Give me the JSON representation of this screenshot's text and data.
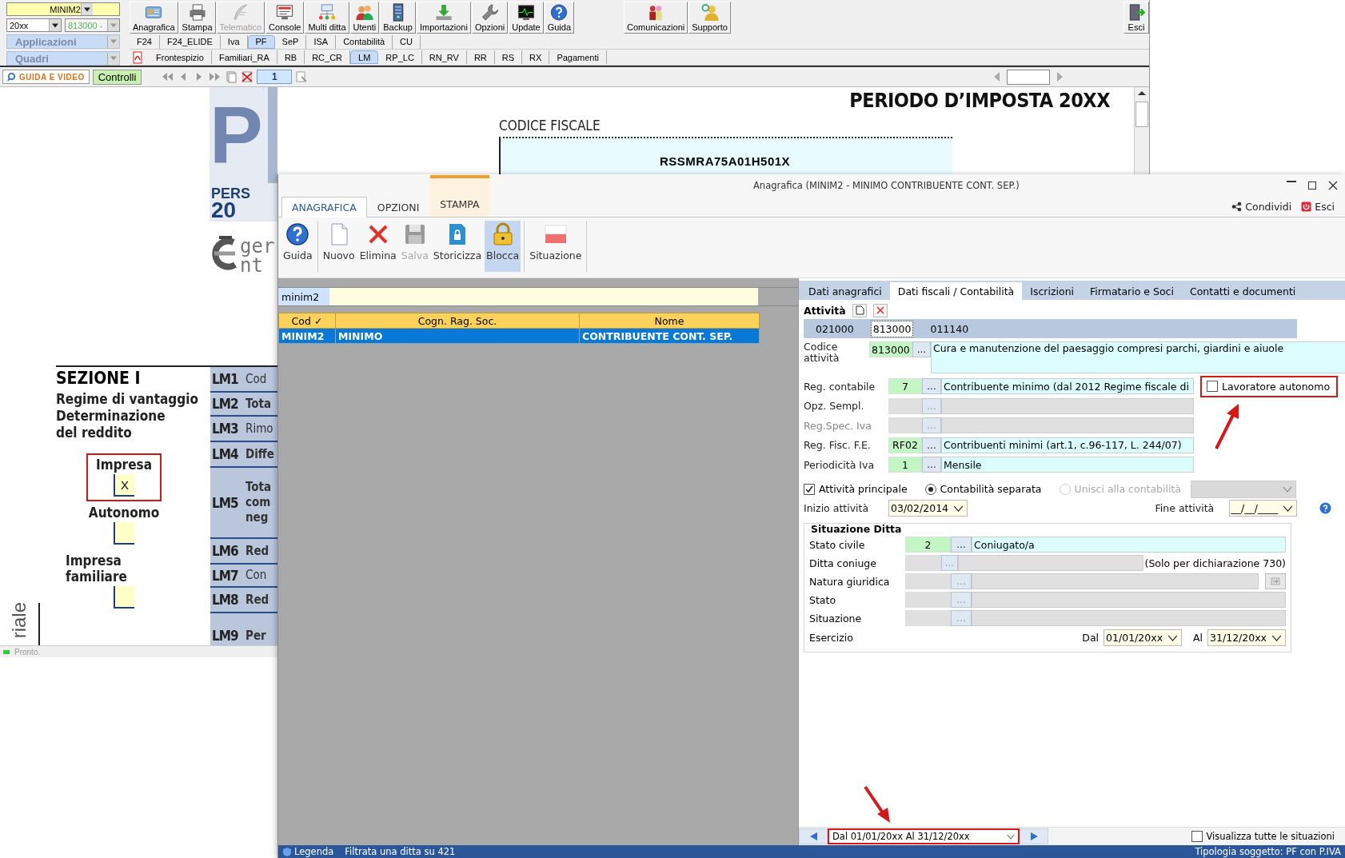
{
  "main_window": {
    "company_selector": {
      "value": "MINIM2"
    },
    "year_selector": {
      "value": "20xx"
    },
    "activity_selector": {
      "value": "813000 -",
      "disabled": true
    },
    "toolbar": [
      {
        "label": "Anagrafica",
        "disabled": false
      },
      {
        "label": "Stampa",
        "disabled": false
      },
      {
        "label": "Telematico",
        "disabled": true
      },
      {
        "label": "Console",
        "disabled": false
      },
      {
        "label": "Multi ditta",
        "disabled": false
      },
      {
        "label": "Utenti",
        "disabled": false
      },
      {
        "label": "Backup",
        "disabled": false
      },
      {
        "label": "Importazioni",
        "disabled": false
      },
      {
        "label": "Opzioni",
        "disabled": false
      },
      {
        "label": "Update",
        "disabled": false
      },
      {
        "label": "Guida",
        "disabled": false
      }
    ],
    "toolbar_right": [
      {
        "label": "Comunicazioni"
      },
      {
        "label": "Supporto"
      }
    ],
    "exit_button": {
      "label": "Esci"
    },
    "applications": {
      "label": "Applicazioni",
      "tabs": [
        {
          "label": "F24",
          "selected": false
        },
        {
          "label": "F24_ELIDE",
          "selected": false
        },
        {
          "label": "Iva",
          "selected": false
        },
        {
          "label": "PF",
          "selected": true
        },
        {
          "label": "SeP",
          "selected": false
        },
        {
          "label": "ISA",
          "selected": false
        },
        {
          "label": "Contabilità",
          "selected": false
        },
        {
          "label": "CU",
          "selected": false
        }
      ]
    },
    "sections": {
      "label": "Quadri",
      "tabs": [
        {
          "label": "Frontespizio",
          "selected": false
        },
        {
          "label": "Familiari_RA",
          "selected": false
        },
        {
          "label": "RB",
          "selected": false
        },
        {
          "label": "RC_CR",
          "selected": false
        },
        {
          "label": "LM",
          "selected": true
        },
        {
          "label": "RP_LC",
          "selected": false
        },
        {
          "label": "RN_RV",
          "selected": false
        },
        {
          "label": "RR",
          "selected": false
        },
        {
          "label": "RS",
          "selected": false
        },
        {
          "label": "RX",
          "selected": false
        },
        {
          "label": "Pagamenti",
          "selected": false
        }
      ]
    },
    "guide_button": {
      "label": "GUIDA E VIDEO"
    },
    "checks_button": {
      "label": "Controlli"
    },
    "page_field": {
      "value": "1"
    },
    "document": {
      "period_title": "PERIODO D’IMPOSTA 20XX",
      "logo": {
        "letters": "P",
        "lines": [
          "PERS",
          "20"
        ]
      },
      "agency_logo": {
        "lines": [
          "ger",
          "nt"
        ]
      },
      "tax_code_label": "CODICE FISCALE",
      "tax_code": "RSSMRA75A01H501X",
      "section_title": "SEZIONE I",
      "section_subtitle": [
        "Regime di vantaggio",
        "Determinazione",
        "del reddito"
      ],
      "options": [
        {
          "label": "Impresa",
          "mark": "X",
          "highlighted": true
        },
        {
          "label": "Autonomo",
          "highlighted": false
        },
        {
          "label": "Impresa familiare",
          "highlighted": false
        }
      ],
      "rows": [
        {
          "code": "LM1",
          "label": [
            "Cod"
          ],
          "bold": false
        },
        {
          "code": "LM2",
          "label": [
            "Tota"
          ],
          "bold": true
        },
        {
          "code": "LM3",
          "label": [
            "Rimo"
          ],
          "bold": false
        },
        {
          "code": "LM4",
          "label": [
            "Diffe"
          ],
          "bold": true
        },
        {
          "code": "LM5",
          "label": [
            "Tota",
            "com",
            "neg"
          ],
          "bold": true
        },
        {
          "code": "LM6",
          "label": [
            "Red"
          ],
          "bold": true
        },
        {
          "code": "LM7",
          "label": [
            "Con"
          ],
          "bold": false
        },
        {
          "code": "LM8",
          "label": [
            "Red"
          ],
          "bold": true
        },
        {
          "code": "LM9",
          "label": [
            "Per"
          ],
          "bold": true
        }
      ],
      "side_text": "riale"
    },
    "status": "Pronto."
  },
  "dialog": {
    "title": "Anagrafica (MINIM2 - MINIMO CONTRIBUENTE CONT. SEP.)",
    "ribbon_tabs": [
      {
        "label": "ANAGRAFICA",
        "selected": true,
        "highlighted": false
      },
      {
        "label": "OPZIONI",
        "selected": false,
        "highlighted": false
      },
      {
        "label": "STAMPA",
        "selected": false,
        "highlighted": true
      }
    ],
    "share_button": {
      "label": "Condividi"
    },
    "exit_button": {
      "label": "Esci"
    },
    "ribbon_groups": [
      {
        "buttons": [
          {
            "label": "Guida",
            "disabled": false,
            "selected": false
          }
        ]
      },
      {
        "buttons": [
          {
            "label": "Nuovo",
            "disabled": false,
            "selected": false
          },
          {
            "label": "Elimina",
            "disabled": false,
            "selected": false
          },
          {
            "label": "Salva",
            "disabled": true,
            "selected": false
          },
          {
            "label": "Storicizza",
            "disabled": false,
            "selected": false
          },
          {
            "label": "Blocca",
            "disabled": false,
            "selected": true
          }
        ]
      },
      {
        "buttons": [
          {
            "label": "Situazione",
            "disabled": false,
            "selected": false
          }
        ]
      }
    ],
    "search": {
      "value": "minim2"
    },
    "grid": {
      "columns": [
        {
          "label": "Cod",
          "mark": "✓"
        },
        {
          "label": "Cogn. Rag. Soc."
        },
        {
          "label": "Nome"
        }
      ],
      "rows": [
        {
          "cells": [
            "MINIM2",
            "MINIMO",
            "CONTRIBUENTE CONT. SEP."
          ],
          "selected": true
        }
      ]
    },
    "detail_tabs": [
      {
        "label": "Dati anagrafici",
        "selected": false
      },
      {
        "label": "Dati fiscali / Contabilità",
        "selected": true
      },
      {
        "label": "Iscrizioni",
        "selected": false
      },
      {
        "label": "Firmatario e Soci",
        "selected": false
      },
      {
        "label": "Contatti e documenti",
        "selected": false
      }
    ],
    "activities": {
      "label": "Attività",
      "tabs": [
        {
          "label": "021000",
          "selected": false
        },
        {
          "label": "813000",
          "selected": true
        },
        {
          "label": "011140",
          "selected": false
        }
      ]
    },
    "fields": [
      {
        "label": "Codice attività",
        "code": "813000",
        "lookup": "...",
        "description": "Cura e manutenzione del paesaggio compresi parchi, giardini e aiuole",
        "kind": "tall",
        "disabled": false
      },
      {
        "label": "Reg. contabile",
        "code": "7",
        "lookup": "...",
        "description": "Contribuente minimo (dal 2012 Regime fiscale di",
        "kind": "code",
        "disabled": false
      },
      {
        "label": "Opz. Sempl.",
        "lookup": "...",
        "kind": "empty",
        "disabled": false
      },
      {
        "label": "Reg.Spec. Iva",
        "lookup": "...",
        "kind": "empty",
        "disabled": true
      },
      {
        "label": "Reg. Fisc. F.E.",
        "code": "RF02",
        "lookup": "...",
        "description": "Contribuenti minimi (art.1, c.96-117, L. 244/07)",
        "kind": "code",
        "disabled": false
      },
      {
        "label": "Periodicità Iva",
        "code": "1",
        "lookup": "...",
        "description": "Mensile",
        "kind": "code",
        "disabled": false
      }
    ],
    "self_employed": {
      "label": "Lavoratore autonomo",
      "checked": false,
      "highlighted": true
    },
    "main_activity": {
      "label": "Attività principale",
      "checked": true
    },
    "accounting_options": [
      {
        "label": "Contabilità separata",
        "selected": true,
        "disabled": false
      },
      {
        "label": "Unisci alla contabilità",
        "selected": false,
        "disabled": true
      }
    ],
    "merge_dropdown": {
      "disabled": true
    },
    "start_date": {
      "label": "Inizio attività",
      "value": "03/02/2014"
    },
    "end_date": {
      "label": "Fine attività",
      "value": "__/__/____"
    },
    "company_status": {
      "title": "Situazione Ditta",
      "fields": [
        {
          "label": "Stato civile",
          "code": "2",
          "lookup": "...",
          "description": "Coniugato/a",
          "kind": "code"
        },
        {
          "label": "Ditta coniuge",
          "lookup": "...",
          "note": "(Solo per dichiarazione 730)",
          "kind": "note"
        },
        {
          "label": "Natura giuridica",
          "lookup": "...",
          "kind": "action"
        },
        {
          "label": "Stato",
          "lookup": "...",
          "kind": "empty"
        },
        {
          "label": "Situazione",
          "lookup": "...",
          "kind": "empty"
        }
      ]
    },
    "fiscal_year": {
      "label": "Esercizio",
      "from_label": "Dal",
      "from": "01/01/20xx",
      "to_label": "Al",
      "to": "31/12/20xx"
    },
    "period_selector": {
      "value": "Dal 01/01/20xx Al 31/12/20xx",
      "highlighted": true
    },
    "show_all": {
      "label": "Visualizza tutte le situazioni",
      "checked": false
    },
    "status_bar": {
      "legend": "Legenda",
      "filter": "Filtrata una ditta su 421",
      "subject_type": "Tipologia soggetto: PF con P.IVA"
    }
  }
}
